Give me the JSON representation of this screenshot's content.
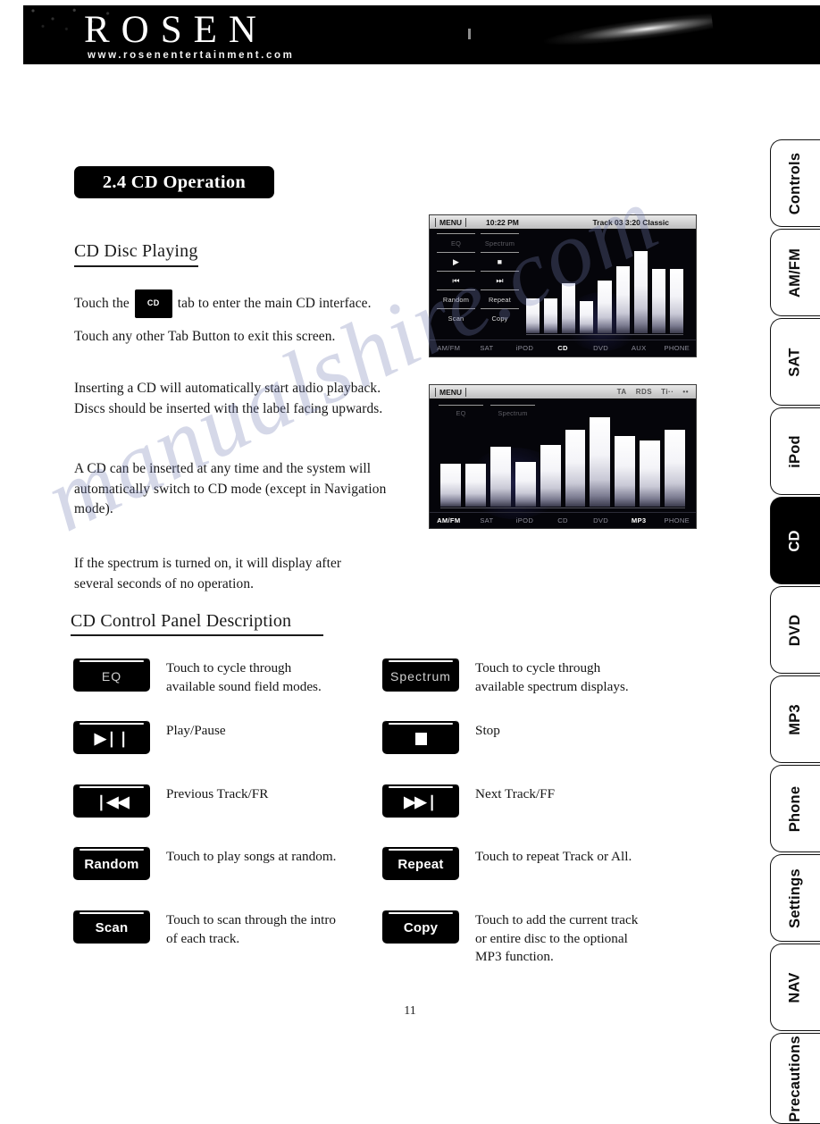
{
  "header": {
    "brand": "ROSEN",
    "url": "www.rosenentertainment.com"
  },
  "section": {
    "title": "2.4 CD Operation"
  },
  "headings": {
    "disc_playing": "CD Disc Playing",
    "control_panel": "CD Control Panel Description"
  },
  "body": {
    "p1_before": "Touch the",
    "p1_chip": "CD",
    "p1_after": "tab to enter the main CD interface.",
    "p2": "Touch any other Tab Button to exit this screen.",
    "p3": "Inserting a CD will automatically start audio playback. Discs should be inserted with the label facing upwards.",
    "p4": "A CD can be inserted at any time and the system will automatically switch to CD mode (except in Navigation mode).",
    "p5": "If the spectrum is turned on, it will display after several seconds of no operation."
  },
  "screenshot1": {
    "status": {
      "menu": "MENU",
      "time": "10:22 PM",
      "track": "Track 03 3:20 Classic"
    },
    "controls": [
      {
        "label": "EQ",
        "style": "dim"
      },
      {
        "label": "Spectrum",
        "style": "dim"
      },
      {
        "label": "▶",
        "style": "glyph"
      },
      {
        "label": "■",
        "style": "glyph"
      },
      {
        "label": "⏮",
        "style": "glyph"
      },
      {
        "label": "⏭",
        "style": "glyph"
      },
      {
        "label": "Random",
        "style": "normal"
      },
      {
        "label": "Repeat",
        "style": "normal"
      },
      {
        "label": "Scan",
        "style": "normal"
      },
      {
        "label": "Copy",
        "style": "normal"
      }
    ],
    "spectrum_bars": [
      30,
      30,
      44,
      28,
      46,
      58,
      72,
      56,
      56
    ],
    "tabs": [
      {
        "label": "AM/FM",
        "active": false
      },
      {
        "label": "SAT",
        "active": false
      },
      {
        "label": "iPOD",
        "active": false
      },
      {
        "label": "CD",
        "active": true
      },
      {
        "label": "DVD",
        "active": false
      },
      {
        "label": "AUX",
        "active": false
      },
      {
        "label": "PHONE",
        "active": false
      }
    ]
  },
  "screenshot2": {
    "status": {
      "menu": "MENU",
      "icons": [
        "TA",
        "RDS",
        "Ti··",
        "••"
      ]
    },
    "controls": [
      {
        "label": "EQ",
        "style": "dim"
      },
      {
        "label": "Spectrum",
        "style": "dim"
      }
    ],
    "spectrum_bars": [
      40,
      40,
      56,
      42,
      58,
      72,
      84,
      66,
      62,
      72
    ],
    "tabs": [
      {
        "label": "AM/FM",
        "active": true
      },
      {
        "label": "SAT",
        "active": false
      },
      {
        "label": "iPOD",
        "active": false
      },
      {
        "label": "CD",
        "active": false
      },
      {
        "label": "DVD",
        "active": false
      },
      {
        "label": "MP3",
        "active": true
      },
      {
        "label": "PHONE",
        "active": false
      }
    ]
  },
  "control_table": {
    "rows": [
      {
        "left": {
          "label": "EQ",
          "glyph": false,
          "weight": "thin",
          "desc": "Touch to cycle through\navailable sound field modes."
        },
        "right": {
          "label": "Spectrum",
          "glyph": false,
          "weight": "thin",
          "desc": "Touch to cycle through\navailable spectrum displays."
        }
      },
      {
        "left": {
          "label": "▶❘❘",
          "glyph": true,
          "weight": "bold",
          "desc": "Play/Pause"
        },
        "right": {
          "label": "stop-square",
          "glyph": true,
          "weight": "bold",
          "desc": "Stop"
        }
      },
      {
        "left": {
          "label": "❘◀◀",
          "glyph": true,
          "weight": "bold",
          "desc": "Previous Track/FR"
        },
        "right": {
          "label": "▶▶❘",
          "glyph": true,
          "weight": "bold",
          "desc": "Next Track/FF"
        }
      },
      {
        "left": {
          "label": "Random",
          "glyph": false,
          "weight": "bold",
          "desc": "Touch to play songs at random."
        },
        "right": {
          "label": "Repeat",
          "glyph": false,
          "weight": "bold",
          "desc": "Touch to repeat Track or All."
        }
      },
      {
        "left": {
          "label": "Scan",
          "glyph": false,
          "weight": "bold",
          "desc": "Touch to scan through the intro\nof each track."
        },
        "right": {
          "label": "Copy",
          "glyph": false,
          "weight": "bold",
          "desc": "Touch to add the current track\nor entire disc to the optional\nMP3 function."
        }
      }
    ]
  },
  "tab_rail": {
    "items": [
      {
        "label": "Controls",
        "active": false
      },
      {
        "label": "AM/FM",
        "active": false
      },
      {
        "label": "SAT",
        "active": false
      },
      {
        "label": "iPod",
        "active": false
      },
      {
        "label": "CD",
        "active": true
      },
      {
        "label": "DVD",
        "active": false
      },
      {
        "label": "MP3",
        "active": false
      },
      {
        "label": "Phone",
        "active": false
      },
      {
        "label": "Settings",
        "active": false
      },
      {
        "label": "NAV",
        "active": false
      },
      {
        "label": "Precautions",
        "active": false
      }
    ]
  },
  "watermark": {
    "line1": "manualshire.com",
    "line2": ""
  },
  "footer": {
    "page_number": "11"
  },
  "colors": {
    "ink": "#111111",
    "panel": "#000000",
    "screen_bg": "#05050a",
    "accent_white": "#ffffff"
  }
}
